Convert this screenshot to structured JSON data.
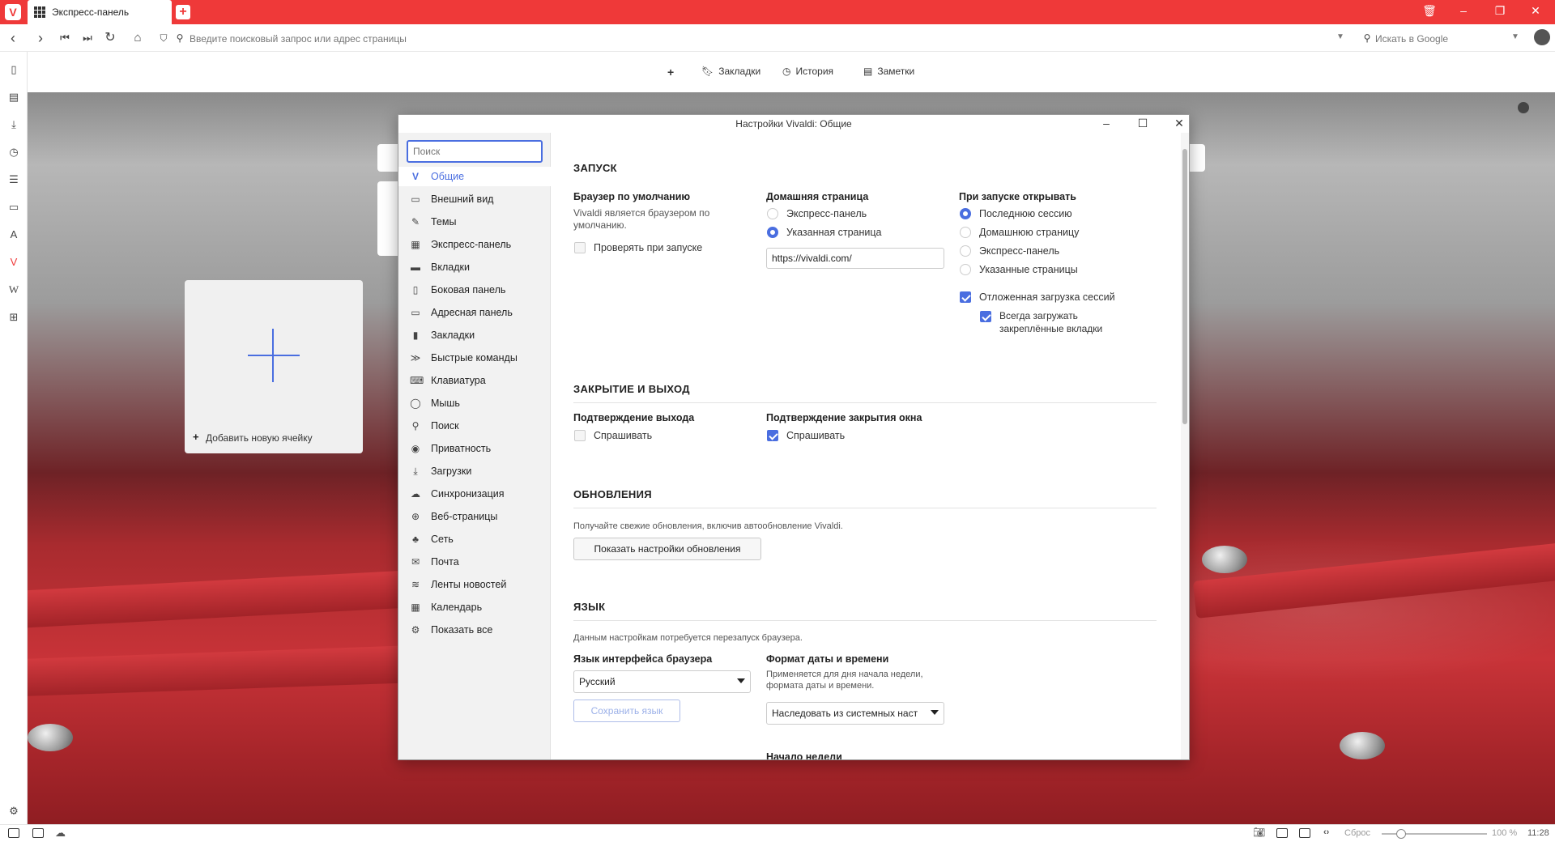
{
  "tabbar": {
    "vivaldi_logo": "V",
    "active_tab": {
      "title": "Экспресс-панель",
      "icon": "grid-icon"
    },
    "new_tab_icon": "+",
    "window_controls": [
      "trash-icon",
      "minimize-icon",
      "restore-icon",
      "close-icon"
    ]
  },
  "addressbar": {
    "url_placeholder": "Введите поисковый запрос или адрес страницы",
    "search_placeholder": "Искать в Google"
  },
  "bookmarkbar": {
    "add_icon": "+",
    "items": [
      "Закладки",
      "История",
      "Заметки"
    ]
  },
  "speed_dial": {
    "add_tile_label": "Добавить новую ячейку",
    "add_tile_plus": "+"
  },
  "statusbar": {
    "reset_label": "Сброс",
    "zoom": "100 %",
    "time": "11:28"
  },
  "settings": {
    "title": "Настройки Vivaldi: Общие",
    "search_placeholder": "Поиск",
    "nav": [
      "Общие",
      "Внешний вид",
      "Темы",
      "Экспресс-панель",
      "Вкладки",
      "Боковая панель",
      "Адресная панель",
      "Закладки",
      "Быстрые команды",
      "Клавиатура",
      "Мышь",
      "Поиск",
      "Приватность",
      "Загрузки",
      "Синхронизация",
      "Веб-страницы",
      "Сеть",
      "Почта",
      "Ленты новостей",
      "Календарь",
      "Показать все"
    ],
    "startup": {
      "title": "ЗАПУСК",
      "default_browser_label": "Браузер по умолчанию",
      "default_browser_note_1": "Vivaldi является браузером по",
      "default_browser_note_2": "умолчанию.",
      "check_on_startup": "Проверять при запуске",
      "homepage_label": "Домашняя страница",
      "homepage_opt_1": "Экспресс-панель",
      "homepage_opt_2": "Указанная страница",
      "homepage_url": "https://vivaldi.com/",
      "on_start_label": "При запуске открывать",
      "on_start_opt_1": "Последнюю сессию",
      "on_start_opt_2": "Домашнюю страницу",
      "on_start_opt_3": "Экспресс-панель",
      "on_start_opt_4": "Указанные страницы",
      "lazy_load": "Отложенная загрузка сессий",
      "always_load_pinned_1": "Всегда загружать",
      "always_load_pinned_2": "закреплённые вкладки"
    },
    "closing": {
      "title": "ЗАКРЫТИЕ И ВЫХОД",
      "exit_confirm_label": "Подтверждение выхода",
      "exit_confirm_ask": "Спрашивать",
      "window_close_label": "Подтверждение закрытия окна",
      "window_close_ask": "Спрашивать"
    },
    "updates": {
      "title": "ОБНОВЛЕНИЯ",
      "note": "Получайте свежие обновления, включив автообновление Vivaldi.",
      "button": "Показать настройки обновления"
    },
    "language": {
      "title": "ЯЗЫК",
      "note": "Данным настройкам потребуется перезапуск браузера.",
      "ui_lang_label": "Язык интерфейса браузера",
      "ui_lang_value": "Русский",
      "save_button": "Сохранить язык",
      "datetime_label": "Формат даты и времени",
      "datetime_note_1": "Применяется для дня начала недели,",
      "datetime_note_2": "формата даты и времени.",
      "datetime_value": "Наследовать из системных наст",
      "week_start_label": "Начало недели"
    }
  }
}
